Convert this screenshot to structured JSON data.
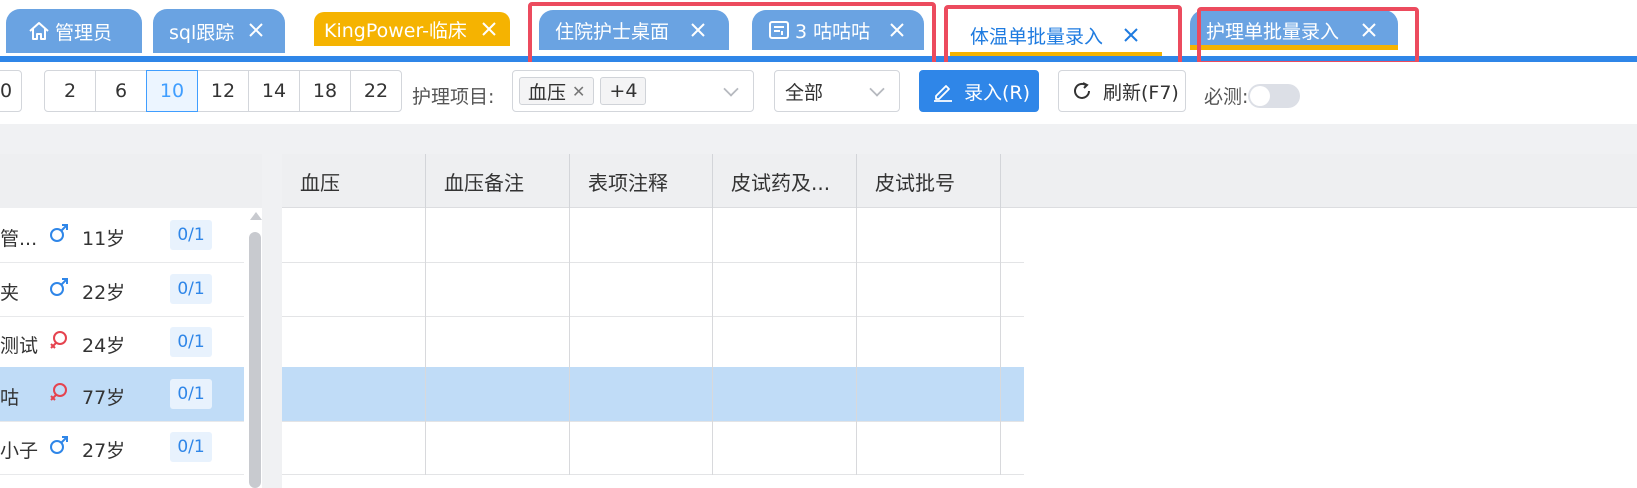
{
  "tabs": [
    {
      "label": "管理员",
      "icon": "home-icon",
      "closable": false
    },
    {
      "label": "sql跟踪",
      "icon": "",
      "closable": true
    },
    {
      "label": "KingPower-临床",
      "icon": "",
      "closable": true
    },
    {
      "label": "住院护士桌面",
      "icon": "",
      "closable": true
    },
    {
      "label": "3 咕咕咕",
      "icon": "note-icon",
      "closable": true
    },
    {
      "label": "体温单批量录入",
      "icon": "",
      "closable": true,
      "active": true
    },
    {
      "label": "护理单批量录入",
      "icon": "",
      "closable": true
    }
  ],
  "add_tab": "+",
  "toolbar": {
    "partial_hour": "0",
    "hours": [
      "2",
      "6",
      "10",
      "12",
      "14",
      "18",
      "22"
    ],
    "selected_hour": "10",
    "nursing_items_label": "护理项目:",
    "nursing_chip": "血压",
    "nursing_more": "+4",
    "scope_select": "全部",
    "entry_button": "录入(R)",
    "refresh_button": "刷新(F7)",
    "required_label": "必测:"
  },
  "patients": [
    {
      "name": "管...",
      "sex": "male",
      "age": "11岁",
      "count": "0/1"
    },
    {
      "name": "夹",
      "sex": "male",
      "age": "22岁",
      "count": "0/1"
    },
    {
      "name": "测试",
      "sex": "female",
      "age": "24岁",
      "count": "0/1"
    },
    {
      "name": "咕",
      "sex": "female",
      "age": "77岁",
      "count": "0/1",
      "selected": true
    },
    {
      "name": "小子",
      "sex": "male",
      "age": "27岁",
      "count": "0/1"
    }
  ],
  "table": {
    "columns": [
      "血压",
      "血压备注",
      "表项注释",
      "皮试药及...",
      "皮试批号"
    ],
    "selected_row": 3
  },
  "colors": {
    "tab_blue": "#6aa3e2",
    "tab_gold": "#f5b301",
    "active_text": "#1e7be0",
    "primary": "#2f86e8",
    "highlight_box": "#ec4b5e",
    "selected_row": "#c0dcf7",
    "male": "#2f86e8",
    "female": "#e5434f"
  }
}
